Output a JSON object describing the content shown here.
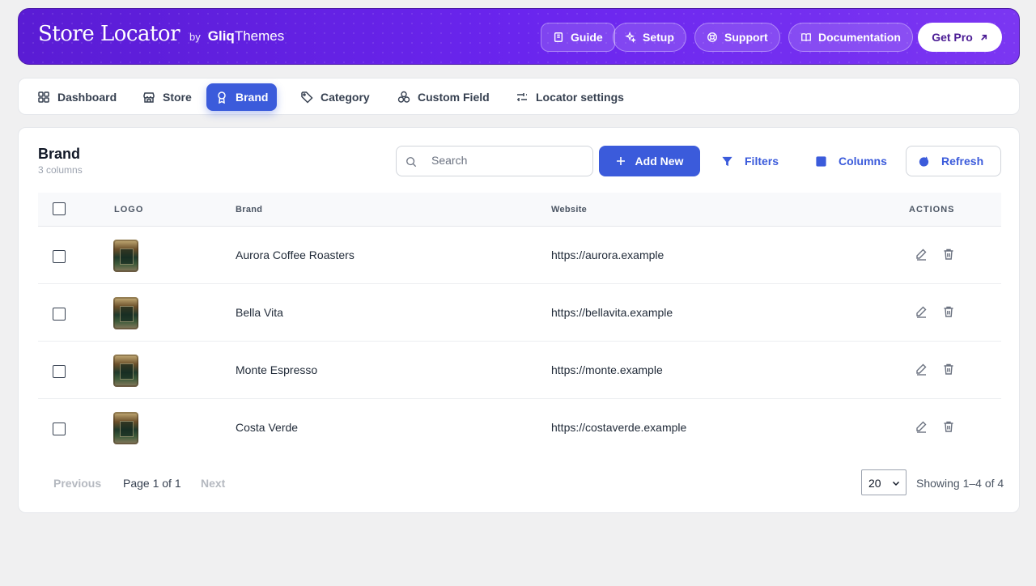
{
  "header": {
    "logo_text": "Store Locator",
    "by_text": "by",
    "company_bold": "Gliq",
    "company_rest": "Themes",
    "buttons": {
      "guide": "Guide",
      "setup": "Setup",
      "support": "Support",
      "documentation": "Documentation",
      "get_pro": "Get Pro"
    },
    "accent": "#6d28f0"
  },
  "nav": {
    "items": [
      {
        "label": "Dashboard",
        "icon": "grid-icon"
      },
      {
        "label": "Store",
        "icon": "storefront-icon"
      },
      {
        "label": "Brand",
        "icon": "badge-icon",
        "active": true
      },
      {
        "label": "Category",
        "icon": "tag-icon"
      },
      {
        "label": "Custom Field",
        "icon": "cubes-icon"
      },
      {
        "label": "Locator settings",
        "icon": "sliders-icon"
      }
    ],
    "active_color": "#3b5bdb"
  },
  "panel": {
    "title": "Brand",
    "subtitle": "3 columns",
    "search_placeholder": "Search",
    "add_new": "Add New",
    "filters": "Filters",
    "columns": "Columns",
    "refresh": "Refresh"
  },
  "table": {
    "headers": {
      "logo": "LOGO",
      "brand": "Brand",
      "website": "Website",
      "actions": "ACTIONS"
    },
    "rows": [
      {
        "brand": "Aurora Coffee Roasters",
        "website": "https://aurora.example"
      },
      {
        "brand": "Bella Vita",
        "website": "https://bellavita.example"
      },
      {
        "brand": "Monte Espresso",
        "website": "https://monte.example"
      },
      {
        "brand": "Costa Verde",
        "website": "https://costaverde.example"
      }
    ]
  },
  "footer": {
    "previous": "Previous",
    "page_info": "Page 1 of 1",
    "next": "Next",
    "page_size": "20",
    "showing": "Showing 1–4 of 4"
  }
}
